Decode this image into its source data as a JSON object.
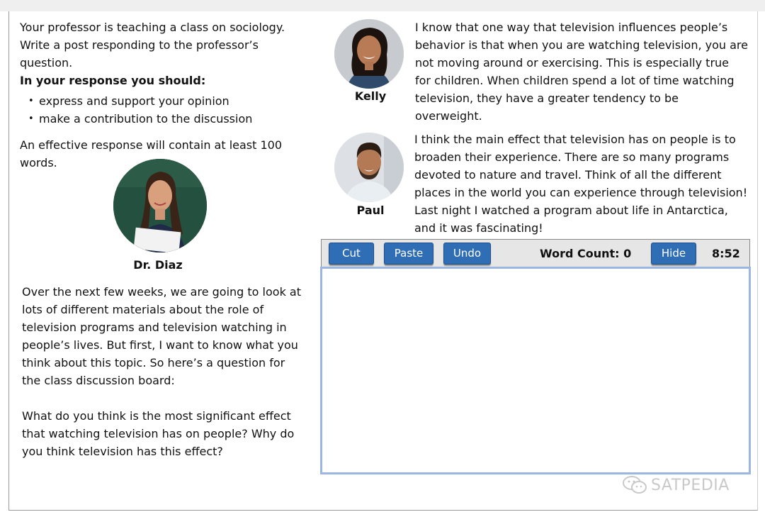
{
  "prompt": {
    "intro": "Your professor is teaching a class on sociology. Write a post responding to the professor’s question.",
    "instructions_heading": "In your response you should:",
    "bullets": [
      "express and support your opinion",
      "make a contribution to the discussion"
    ],
    "effective_response": "An effective response will contain at least 100 words."
  },
  "professor": {
    "name": "Dr. Diaz",
    "paragraph1": "Over the next few weeks, we are going to look at lots of different materials about the role of television programs and television watching in people’s lives. But first, I want to know what you think about this topic. So here’s a question for the class discussion board:",
    "paragraph2": "What do you think is the most significant effect that watching television has on people? Why do you think television has this effect?"
  },
  "students": [
    {
      "name": "Kelly",
      "text": "I know that one way that television influences people’s behavior is that when you are watching television, you are not moving around or exercising. This is especially true for children. When children spend a lot of time watching television, they have a greater tendency to be overweight."
    },
    {
      "name": "Paul",
      "text": "I think the main effect that television has on people is to broaden their experience. There are so many programs devoted to nature and travel. Think of all the different places in the world you can experience through television! Last night I watched a program about life in Antarctica, and it was fascinating!"
    }
  ],
  "toolbar": {
    "cut_label": "Cut",
    "paste_label": "Paste",
    "undo_label": "Undo",
    "word_count_label": "Word Count:",
    "word_count_value": "0",
    "hide_label": "Hide",
    "timer": "8:52"
  },
  "response_box": {
    "value": ""
  },
  "watermark": {
    "text": "SATPEDIA",
    "icon": "wechat-icon"
  },
  "colors": {
    "button_blue": "#2f6db5",
    "response_border": "#9bb6e0",
    "toolbar_bg": "#e6e6e6"
  }
}
